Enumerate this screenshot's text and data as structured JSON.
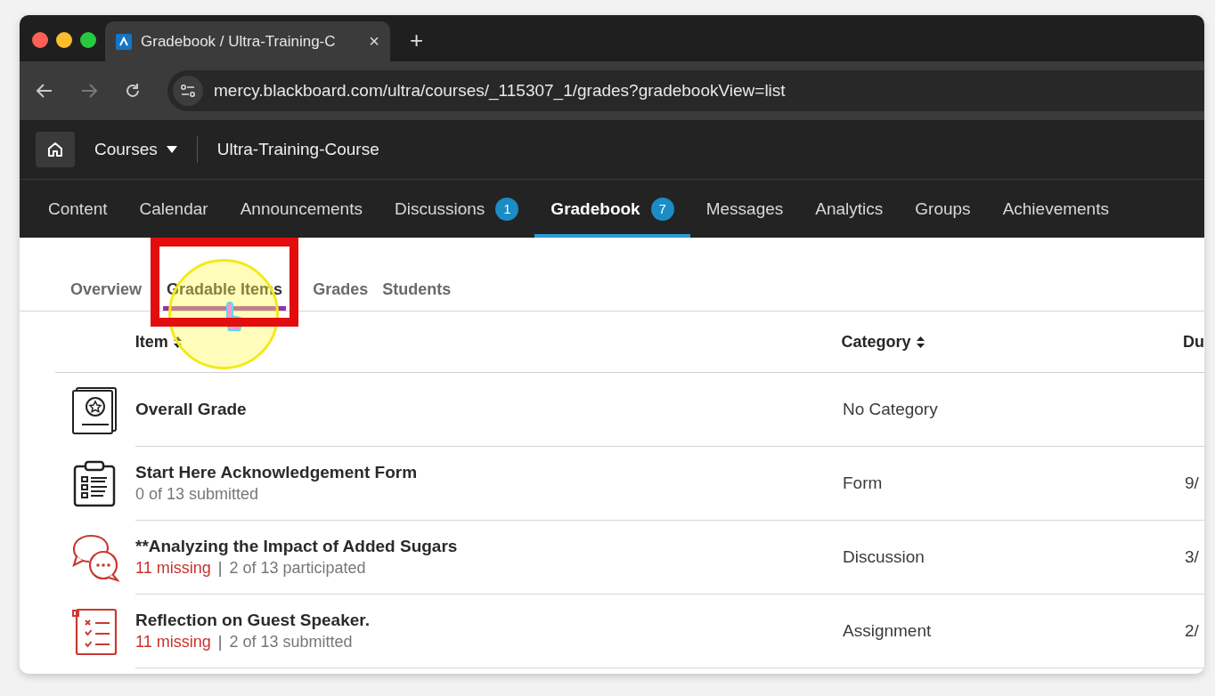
{
  "browser": {
    "tab_title": "Gradebook / Ultra-Training-C",
    "tab_close": "×",
    "new_tab": "+",
    "url": "mercy.blackboard.com/ultra/courses/_115307_1/grades?gradebookView=list"
  },
  "course_header": {
    "courses_menu": "Courses",
    "course_name": "Ultra-Training-Course"
  },
  "course_nav": [
    {
      "label": "Content",
      "selected": false
    },
    {
      "label": "Calendar",
      "selected": false
    },
    {
      "label": "Announcements",
      "selected": false
    },
    {
      "label": "Discussions",
      "badge": "1",
      "selected": false
    },
    {
      "label": "Gradebook",
      "badge": "7",
      "selected": true
    },
    {
      "label": "Messages",
      "selected": false
    },
    {
      "label": "Analytics",
      "selected": false
    },
    {
      "label": "Groups",
      "selected": false
    },
    {
      "label": "Achievements",
      "selected": false
    }
  ],
  "gradebook_tabs": [
    {
      "label": "Overview",
      "selected": false,
      "highlighted": false
    },
    {
      "label": "Gradable Items",
      "selected": true,
      "highlighted": true
    },
    {
      "label": "Grades",
      "selected": false,
      "highlighted": false
    },
    {
      "label": "Students",
      "selected": false,
      "highlighted": false
    }
  ],
  "table": {
    "columns": [
      {
        "label": "Item",
        "sortable": true
      },
      {
        "label": "Category",
        "sortable": true
      },
      {
        "label": "Du",
        "sortable": false
      }
    ],
    "rows": [
      {
        "kind": "overall",
        "title": "Overall Grade",
        "category": "No Category"
      },
      {
        "kind": "form",
        "title": "Start Here Acknowledgement Form",
        "detail": "0 of 13 submitted",
        "category": "Form",
        "due": "9/"
      },
      {
        "kind": "discussion",
        "title": "**Analyzing the Impact of Added Sugars",
        "missing": "11 missing",
        "separator": "|",
        "detail": "2 of 13 participated",
        "category": "Discussion",
        "due": "3/"
      },
      {
        "kind": "assignment",
        "title": "Reflection on Guest Speaker.",
        "missing": "11 missing",
        "separator": "|",
        "detail": "2 of 13 submitted",
        "category": "Assignment",
        "due": "2/"
      }
    ]
  }
}
